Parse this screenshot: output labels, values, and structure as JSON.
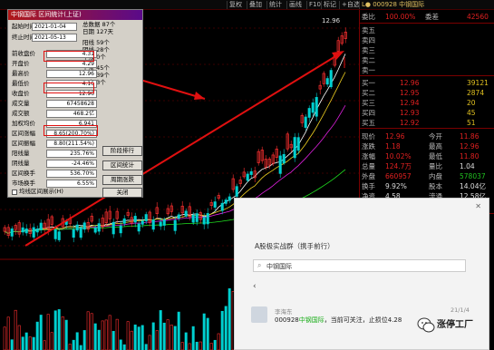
{
  "toolbar": {
    "tabs": [
      "复权",
      "叠加",
      "统计",
      "画线",
      "F10",
      "标记",
      "+自选",
      "返回"
    ]
  },
  "chart": {
    "high_label": "12.96",
    "stock_bar": "L● 000928 中钢国际"
  },
  "dialog": {
    "title": "中钢国际 区间统计(上证)",
    "start_label": "起始时间",
    "start_value": "2021-01-04",
    "end_label": "终止时间",
    "end_value": "2021-05-13",
    "right_top": [
      "总数据 87个",
      "日期 127天"
    ],
    "right_stats": [
      "阳线 59个",
      "阴线 28个",
      "平线 0个"
    ],
    "right_stats2": [
      "上涨 45个",
      "下跌 39个",
      "平盘 3个"
    ],
    "rows": [
      {
        "label": "前收盘价",
        "value": "4.31"
      },
      {
        "label": "开盘价",
        "value": "4.29"
      },
      {
        "label": "最高价",
        "value": "12.96"
      },
      {
        "label": "最低价",
        "value": "4.16"
      },
      {
        "label": "收盘价",
        "value": "12.96"
      },
      {
        "label": "成交量",
        "value": "67458628"
      },
      {
        "label": "成交额",
        "value": "468.2亿"
      },
      {
        "label": "加权均价",
        "value": "6.941"
      },
      {
        "label": "区间涨幅",
        "value": "8.65(200.70%)"
      },
      {
        "label": "区间振幅",
        "value": "8.80(211.54%)"
      },
      {
        "label": "阳线量",
        "value": "235.76%"
      },
      {
        "label": "阴线量",
        "value": "-24.46%"
      },
      {
        "label": "区间换手",
        "value": "536.70%"
      },
      {
        "label": "市场换手",
        "value": "6.55%"
      }
    ],
    "btn_stage": "阶段排行",
    "btn_period": "区间统计",
    "btn_cycle": "周期涨跌",
    "btn_close": "关闭",
    "check_label": "均线区间展示(H)"
  },
  "prices": {
    "header_left": "委比",
    "header_mid": "100.00%",
    "header_right": "委差",
    "header_val": "42560",
    "sell": [
      {
        "label": "卖五",
        "price": "",
        "vol": ""
      },
      {
        "label": "卖四",
        "price": "",
        "vol": ""
      },
      {
        "label": "卖三",
        "price": "",
        "vol": ""
      },
      {
        "label": "卖二",
        "price": "",
        "vol": ""
      },
      {
        "label": "卖一",
        "price": "",
        "vol": ""
      }
    ],
    "buy": [
      {
        "label": "买一",
        "price": "12.96",
        "vol": "39121"
      },
      {
        "label": "买二",
        "price": "12.95",
        "vol": "2874"
      },
      {
        "label": "买三",
        "price": "12.94",
        "vol": "20"
      },
      {
        "label": "买四",
        "price": "12.93",
        "vol": "45"
      },
      {
        "label": "买五",
        "price": "12.92",
        "vol": "51"
      }
    ],
    "stats": [
      {
        "l": "现价",
        "v": "12.96",
        "l2": "今开",
        "v2": "11.86"
      },
      {
        "l": "涨跌",
        "v": "1.18",
        "l2": "最高",
        "v2": "12.96"
      },
      {
        "l": "涨幅",
        "v": "10.02%",
        "l2": "最低",
        "v2": "11.80"
      },
      {
        "l": "总量",
        "v": "124.7万",
        "l2": "量比",
        "v2": "1.04"
      },
      {
        "l": "外盘",
        "v": "660957",
        "l2": "内盘",
        "v2": "578037"
      },
      {
        "l": "换手",
        "v": "9.92%",
        "l2": "股本",
        "v2": "14.04亿"
      },
      {
        "l": "净资",
        "v": "4.58",
        "l2": "流通",
        "v2": "12.58亿"
      },
      {
        "l": "收益",
        "v": "0.098",
        "l2": "PE(动)",
        "v2": "33.1"
      }
    ],
    "ticks": [
      {
        "t": "14:55",
        "p": "12.96",
        "v": "23"
      },
      {
        "t": "14:56",
        "p": "12.96",
        "v": "120"
      },
      {
        "t": "14:57",
        "p": "12.96",
        "v": "34"
      },
      {
        "t": "15:00",
        "p": "12.96",
        "v": "128"
      }
    ]
  },
  "wechat": {
    "chat_title": "A股极实战群（携手前行）",
    "search_placeholder": "中钢国际",
    "sender": "李海东",
    "date": "21/1/4",
    "msg_code": "000928",
    "msg_name": "中钢国际",
    "msg_rest": "，当前可关注，止损位4.28"
  },
  "watermark": {
    "text": "涨停工厂"
  }
}
